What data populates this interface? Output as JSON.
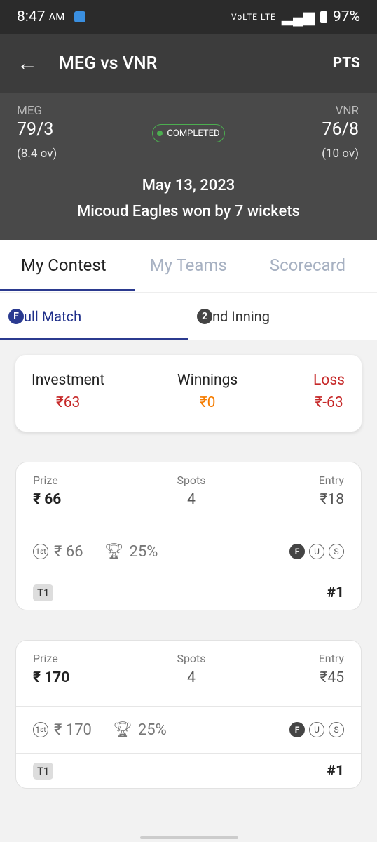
{
  "status": {
    "time": "8:47",
    "ampm": "AM",
    "network": "VoLTE LTE",
    "battery": "97%"
  },
  "header": {
    "title": "MEG vs VNR",
    "pts": "PTS"
  },
  "match": {
    "team1": {
      "name": "MEG",
      "score": "79/3",
      "overs": "(8.4 ov)"
    },
    "team2": {
      "name": "VNR",
      "score": "76/8",
      "overs": "(10 ov)"
    },
    "status": "COMPLETED",
    "date": "May 13, 2023",
    "result": "Micoud Eagles won by 7 wickets"
  },
  "tabs": [
    "My Contest",
    "My Teams",
    "Scorecard"
  ],
  "subtabs": [
    {
      "icon": "F",
      "label": "ull Match"
    },
    {
      "icon": "2",
      "label": "nd Inning"
    }
  ],
  "summary": {
    "investment_label": "Investment",
    "investment": "₹63",
    "winnings_label": "Winnings",
    "winnings": "₹0",
    "loss_label": "Loss",
    "loss": "₹-63",
    "colors": {
      "investment": "#c62828",
      "winnings": "#f57c00",
      "loss": "#c62828"
    }
  },
  "contests": [
    {
      "prize_label": "Prize",
      "prize": "₹ 66",
      "spots_label": "Spots",
      "spots": "4",
      "entry_label": "Entry",
      "entry": "₹18",
      "first_prize": "₹ 66",
      "winners_pct": "25%",
      "badges": [
        "F",
        "U",
        "S"
      ],
      "team": "T1",
      "rank": "#1"
    },
    {
      "prize_label": "Prize",
      "prize": "₹ 170",
      "spots_label": "Spots",
      "spots": "4",
      "entry_label": "Entry",
      "entry": "₹45",
      "first_prize": "₹ 170",
      "winners_pct": "25%",
      "badges": [
        "F",
        "U",
        "S"
      ],
      "team": "T1",
      "rank": "#1"
    }
  ]
}
